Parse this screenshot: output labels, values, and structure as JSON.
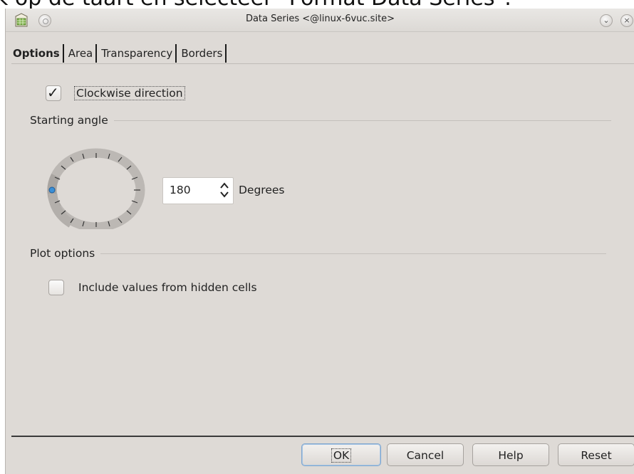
{
  "caption": "k op de taart en selecteer \"Format Data Series\".",
  "window": {
    "title": "Data Series <@linux-6vuc.site>",
    "app_icon": "calc-app-icon",
    "buttons": {
      "menu": "window-menu-icon",
      "minimize": "minimize-icon",
      "close": "close-icon"
    }
  },
  "tabs": [
    {
      "label": "Options",
      "active": true
    },
    {
      "label": "Area",
      "active": false
    },
    {
      "label": "Transparency",
      "active": false
    },
    {
      "label": "Borders",
      "active": false
    }
  ],
  "options": {
    "clockwise": {
      "label": "Clockwise direction",
      "checked": true
    },
    "starting_angle": {
      "title": "Starting angle",
      "value": "180",
      "unit_label": "Degrees"
    },
    "plot_options": {
      "title": "Plot options",
      "include_hidden": {
        "label": "Include values from hidden cells",
        "checked": false
      }
    }
  },
  "footer": {
    "ok": "OK",
    "cancel": "Cancel",
    "help": "Help",
    "reset": "Reset"
  },
  "colors": {
    "window_bg": "#dedad6",
    "focus_blue": "#7ea6cf",
    "dial_indicator": "#3b8fd6"
  }
}
